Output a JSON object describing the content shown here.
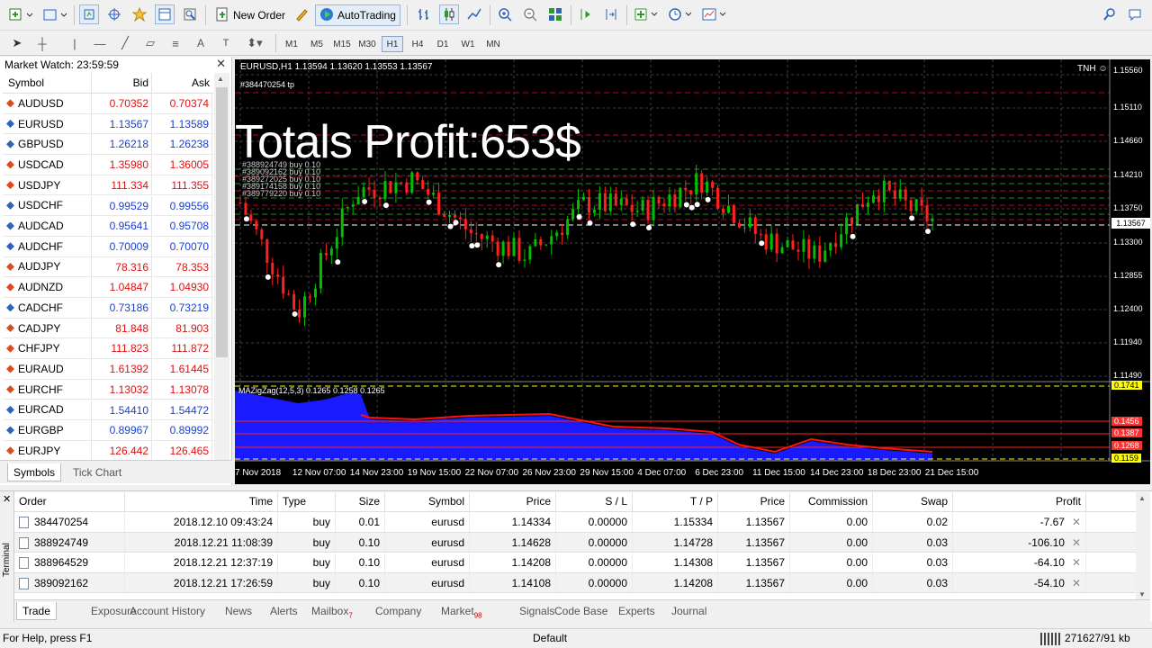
{
  "toolbar": {
    "new_order_label": "New Order",
    "autotrading_label": "AutoTrading",
    "icons": [
      "new-chart-icon",
      "profiles-icon",
      "market-watch-icon",
      "navigator-icon",
      "favorites-icon",
      "terminal-icon",
      "tester-icon",
      "new-order-icon",
      "metaeditor-icon",
      "autotrading-icon",
      "bar-chart-icon",
      "candlestick-icon",
      "line-chart-icon",
      "zoom-in-icon",
      "zoom-out-icon",
      "tile-windows-icon",
      "chart-shift-icon",
      "autoscroll-icon",
      "indicators-icon",
      "periods-icon",
      "templates-icon",
      "search-icon",
      "chat-icon"
    ]
  },
  "timeframes": [
    "M1",
    "M5",
    "M15",
    "M30",
    "H1",
    "H4",
    "D1",
    "W1",
    "MN"
  ],
  "active_timeframe": "H1",
  "market_watch": {
    "title": "Market Watch: 23:59:59",
    "columns": [
      "Symbol",
      "Bid",
      "Ask"
    ],
    "rows": [
      {
        "symbol": "AUDUSD",
        "bid": "0.70352",
        "ask": "0.70374",
        "dir": "down"
      },
      {
        "symbol": "EURUSD",
        "bid": "1.13567",
        "ask": "1.13589",
        "dir": "up"
      },
      {
        "symbol": "GBPUSD",
        "bid": "1.26218",
        "ask": "1.26238",
        "dir": "up"
      },
      {
        "symbol": "USDCAD",
        "bid": "1.35980",
        "ask": "1.36005",
        "dir": "down"
      },
      {
        "symbol": "USDJPY",
        "bid": "111.334",
        "ask": "111.355",
        "dir": "down"
      },
      {
        "symbol": "USDCHF",
        "bid": "0.99529",
        "ask": "0.99556",
        "dir": "up"
      },
      {
        "symbol": "AUDCAD",
        "bid": "0.95641",
        "ask": "0.95708",
        "dir": "up"
      },
      {
        "symbol": "AUDCHF",
        "bid": "0.70009",
        "ask": "0.70070",
        "dir": "up"
      },
      {
        "symbol": "AUDJPY",
        "bid": "78.316",
        "ask": "78.353",
        "dir": "down"
      },
      {
        "symbol": "AUDNZD",
        "bid": "1.04847",
        "ask": "1.04930",
        "dir": "down"
      },
      {
        "symbol": "CADCHF",
        "bid": "0.73186",
        "ask": "0.73219",
        "dir": "up"
      },
      {
        "symbol": "CADJPY",
        "bid": "81.848",
        "ask": "81.903",
        "dir": "down"
      },
      {
        "symbol": "CHFJPY",
        "bid": "111.823",
        "ask": "111.872",
        "dir": "down"
      },
      {
        "symbol": "EURAUD",
        "bid": "1.61392",
        "ask": "1.61445",
        "dir": "down"
      },
      {
        "symbol": "EURCHF",
        "bid": "1.13032",
        "ask": "1.13078",
        "dir": "down"
      },
      {
        "symbol": "EURCAD",
        "bid": "1.54410",
        "ask": "1.54472",
        "dir": "up"
      },
      {
        "symbol": "EURGBP",
        "bid": "0.89967",
        "ask": "0.89992",
        "dir": "up"
      },
      {
        "symbol": "EURJPY",
        "bid": "126.442",
        "ask": "126.465",
        "dir": "down"
      }
    ],
    "tabs": [
      "Symbols",
      "Tick Chart"
    ],
    "active_tab": "Symbols"
  },
  "chart": {
    "title": "EURUSD,H1  1.13594 1.13620 1.13553 1.13567",
    "order_tag": "#384470254 tp",
    "tnh_label": "TNH",
    "overlay_text": "Totals Profit:653$",
    "order_labels": [
      "#384470254 tp",
      "#388924749 buy 0.10",
      "#389092162 buy 0.10",
      "#389272025 buy 0.10",
      "#389174158 buy 0.10",
      "#389779220 buy 0.10"
    ],
    "indicator_label": "MAZigZag(12,5,3) 0.1265 0.1258 0.1265",
    "current_price": "1.13567",
    "price_labels": [
      "1.15560",
      "1.15110",
      "1.14660",
      "1.14210",
      "1.13750",
      "1.13300",
      "1.12855",
      "1.12400",
      "1.11940",
      "1.11490"
    ],
    "indicator_price_labels": [
      "0.1741",
      "0.1456",
      "0.1387",
      "0.1268",
      "0.1159"
    ],
    "x_labels": [
      "7 Nov 2018",
      "12 Nov 07:00",
      "14 Nov 23:00",
      "19 Nov 15:00",
      "22 Nov 07:00",
      "26 Nov 23:00",
      "29 Nov 15:00",
      "4 Dec 07:00",
      "6 Dec 23:00",
      "11 Dec 15:00",
      "14 Dec 23:00",
      "18 Dec 23:00",
      "21 Dec 15:00"
    ],
    "colors": {
      "bull": "#00c000",
      "bear": "#ff2020",
      "indicator_fill": "#1a1aff",
      "indicator_line": "#ff1010",
      "grid": "#404040"
    }
  },
  "chart_data": {
    "type": "line",
    "title": "EURUSD,H1",
    "xlabel": "",
    "ylabel": "",
    "x": [
      "7 Nov 2018",
      "12 Nov 07:00",
      "14 Nov 23:00",
      "19 Nov 15:00",
      "22 Nov 07:00",
      "26 Nov 23:00",
      "29 Nov 15:00",
      "4 Dec 07:00",
      "6 Dec 23:00",
      "11 Dec 15:00",
      "14 Dec 23:00",
      "18 Dec 23:00",
      "21 Dec 15:00"
    ],
    "series": [
      {
        "name": "EURUSD",
        "values": [
          1.138,
          1.1235,
          1.1395,
          1.141,
          1.134,
          1.131,
          1.138,
          1.137,
          1.141,
          1.1335,
          1.131,
          1.14,
          1.1357
        ]
      }
    ],
    "ylim": [
      1.1149,
      1.1556
    ]
  },
  "terminal": {
    "label": "Terminal",
    "columns": [
      "Order",
      "Time",
      "Type",
      "Size",
      "Symbol",
      "Price",
      "S / L",
      "T / P",
      "Price",
      "Commission",
      "Swap",
      "Profit"
    ],
    "rows": [
      {
        "order": "384470254",
        "time": "2018.12.10 09:43:24",
        "type": "buy",
        "size": "0.01",
        "symbol": "eurusd",
        "price": "1.14334",
        "sl": "0.00000",
        "tp": "1.15334",
        "cur": "1.13567",
        "comm": "0.00",
        "swap": "0.02",
        "profit": "-7.67"
      },
      {
        "order": "388924749",
        "time": "2018.12.21 11:08:39",
        "type": "buy",
        "size": "0.10",
        "symbol": "eurusd",
        "price": "1.14628",
        "sl": "0.00000",
        "tp": "1.14728",
        "cur": "1.13567",
        "comm": "0.00",
        "swap": "0.03",
        "profit": "-106.10"
      },
      {
        "order": "388964529",
        "time": "2018.12.21 12:37:19",
        "type": "buy",
        "size": "0.10",
        "symbol": "eurusd",
        "price": "1.14208",
        "sl": "0.00000",
        "tp": "1.14308",
        "cur": "1.13567",
        "comm": "0.00",
        "swap": "0.03",
        "profit": "-64.10"
      },
      {
        "order": "389092162",
        "time": "2018.12.21 17:26:59",
        "type": "buy",
        "size": "0.10",
        "symbol": "eurusd",
        "price": "1.14108",
        "sl": "0.00000",
        "tp": "1.14208",
        "cur": "1.13567",
        "comm": "0.00",
        "swap": "0.03",
        "profit": "-54.10"
      }
    ],
    "tabs": [
      {
        "label": "Trade",
        "badge": ""
      },
      {
        "label": "Exposure",
        "badge": ""
      },
      {
        "label": "Account History",
        "badge": ""
      },
      {
        "label": "News",
        "badge": ""
      },
      {
        "label": "Alerts",
        "badge": ""
      },
      {
        "label": "Mailbox",
        "badge": "7"
      },
      {
        "label": "Company",
        "badge": ""
      },
      {
        "label": "Market",
        "badge": "98"
      },
      {
        "label": "Signals",
        "badge": ""
      },
      {
        "label": "Code Base",
        "badge": ""
      },
      {
        "label": "Experts",
        "badge": ""
      },
      {
        "label": "Journal",
        "badge": ""
      }
    ],
    "active_tab": "Trade"
  },
  "status": {
    "help": "For Help, press F1",
    "profile": "Default",
    "network": "271627/91 kb"
  }
}
